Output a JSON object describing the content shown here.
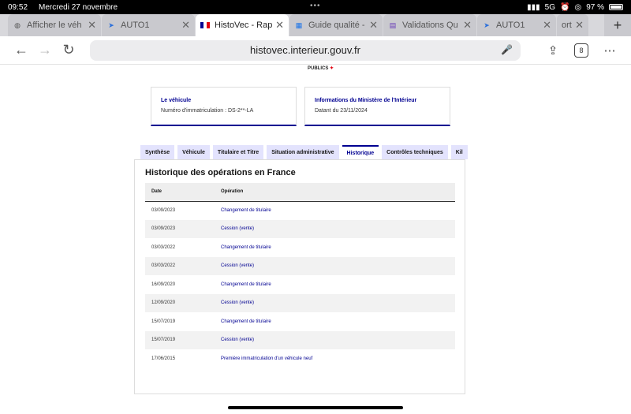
{
  "status": {
    "time": "09:52",
    "date": "Mercredi 27 novembre",
    "network": "5G",
    "battery": "97 %"
  },
  "tabs": [
    {
      "label": "Afficher le véh",
      "icon": "globe-icon",
      "active": false
    },
    {
      "label": "AUTO1",
      "icon": "auto1-icon",
      "active": false
    },
    {
      "label": "HistoVec - Rap",
      "icon": "french-flag-icon",
      "active": true
    },
    {
      "label": "Guide qualité -",
      "icon": "doc-icon",
      "active": false
    },
    {
      "label": "Validations Qu",
      "icon": "forms-icon",
      "active": false
    },
    {
      "label": "AUTO1",
      "icon": "auto1-icon",
      "active": false
    }
  ],
  "tab_partial": "ort",
  "toolbar": {
    "url": "histovec.interieur.gouv.fr",
    "tab_count": "8"
  },
  "logo": {
    "text": "PUBLICS"
  },
  "vehicle_card": {
    "title": "Le véhicule",
    "value": "Numéro d'immatriculation : DS-2**-LA"
  },
  "ministry_card": {
    "title": "Informations du Ministère de l'Intérieur",
    "value": "Datant du 23/11/2024"
  },
  "page_tabs": [
    {
      "label": "Synthèse",
      "active": false
    },
    {
      "label": "Véhicule",
      "active": false
    },
    {
      "label": "Titulaire et Titre",
      "active": false
    },
    {
      "label": "Situation administrative",
      "active": false
    },
    {
      "label": "Historique",
      "active": true
    },
    {
      "label": "Contrôles techniques",
      "active": false
    },
    {
      "label": "Kil",
      "active": false
    }
  ],
  "history": {
    "title": "Historique des opérations en France",
    "headers": {
      "date": "Date",
      "operation": "Opération"
    },
    "rows": [
      {
        "date": "03/09/2023",
        "operation": "Changement de titulaire"
      },
      {
        "date": "03/09/2023",
        "operation": "Cession (vente)"
      },
      {
        "date": "03/03/2022",
        "operation": "Changement de titulaire"
      },
      {
        "date": "03/03/2022",
        "operation": "Cession (vente)"
      },
      {
        "date": "16/09/2020",
        "operation": "Changement de titulaire"
      },
      {
        "date": "12/09/2020",
        "operation": "Cession (vente)"
      },
      {
        "date": "15/07/2019",
        "operation": "Changement de titulaire"
      },
      {
        "date": "15/07/2019",
        "operation": "Cession (vente)"
      },
      {
        "date": "17/06/2015",
        "operation": "Première immatriculation d'un véhicule neuf"
      }
    ]
  }
}
